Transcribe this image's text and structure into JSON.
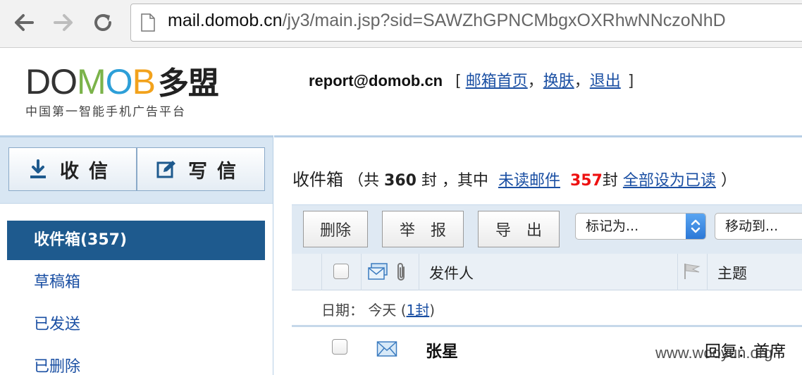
{
  "browser": {
    "url_host": "mail.domob.cn",
    "url_path": "/jy3/main.jsp?sid=SAWZhGPNCMbgxOXRhwNNczoNhD"
  },
  "logo": {
    "brand_d": "D",
    "brand_o1": "O",
    "brand_m": "M",
    "brand_o2": "O",
    "brand_b": "B",
    "brand_cn": "多盟",
    "slogan": "中国第一智能手机广告平台"
  },
  "userbar": {
    "email": "report@domob.cn",
    "open_bracket": "[",
    "home_link": "邮箱首页",
    "skin_link": "换肤",
    "logout_link": "退出",
    "comma": "，",
    "close_bracket": "]"
  },
  "sidebar": {
    "receive_label": "收信",
    "compose_label": "写信",
    "folders": [
      {
        "label": "收件箱(357)"
      },
      {
        "label": "草稿箱"
      },
      {
        "label": "已发送"
      },
      {
        "label": "已删除"
      }
    ]
  },
  "inbox": {
    "title": "收件箱",
    "total_prefix": "（共",
    "total_count": "360",
    "total_suffix": "封 ，其中",
    "unread_link": "未读邮件",
    "unread_count": "357",
    "unread_unit": "封",
    "mark_all_read_link": "全部设为已读",
    "close_paren": "）"
  },
  "toolbar": {
    "delete_label": "删除",
    "report_label": "举　报",
    "export_label": "导　出",
    "mark_as_placeholder": "标记为...",
    "move_to_placeholder": "移动到..."
  },
  "table": {
    "sender_header": "发件人",
    "subject_header": "主题",
    "date_group_label": "日期：",
    "date_group_day": "今天",
    "date_group_open": "(",
    "date_group_count_link": "1封",
    "date_group_close": ")",
    "rows": [
      {
        "sender": "张星",
        "subject": "回复：首席"
      }
    ]
  },
  "watermark": "www.wooyun.org",
  "colors": {
    "accent": "#1e5a8e",
    "link": "#1a4fa3",
    "unread_count": "#e11111"
  }
}
